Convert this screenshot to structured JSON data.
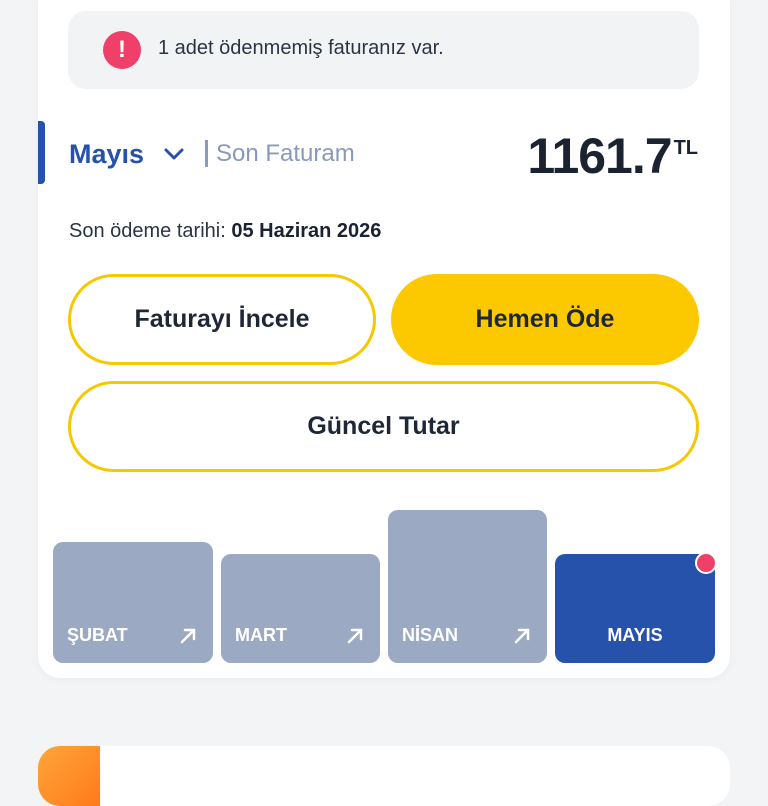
{
  "alert": {
    "icon": "exclamation-icon",
    "icon_glyph": "!",
    "text": "1 adet ödenmemiş faturanız var."
  },
  "invoice": {
    "month": "Mayıs",
    "subtitle": "Son Faturam",
    "amount": "1161.7",
    "currency": "TL",
    "due_label": "Son ödeme tarihi:",
    "due_date": "05 Haziran 2026"
  },
  "buttons": {
    "review": "Faturayı İncele",
    "pay_now": "Hemen Öde",
    "current_amount": "Güncel Tutar"
  },
  "history": {
    "items": [
      {
        "label": "ŞUBAT",
        "level": 0.77,
        "active": false
      },
      {
        "label": "MART",
        "level": 0.72,
        "active": false
      },
      {
        "label": "NİSAN",
        "level": 1.0,
        "active": false
      },
      {
        "label": "MAYIS",
        "level": 0.72,
        "active": true
      }
    ]
  },
  "colors": {
    "brand_blue": "#2752ac",
    "accent_yellow": "#fcc900",
    "alert_red": "#f0406a",
    "bar_gray": "#9ba9c3"
  }
}
